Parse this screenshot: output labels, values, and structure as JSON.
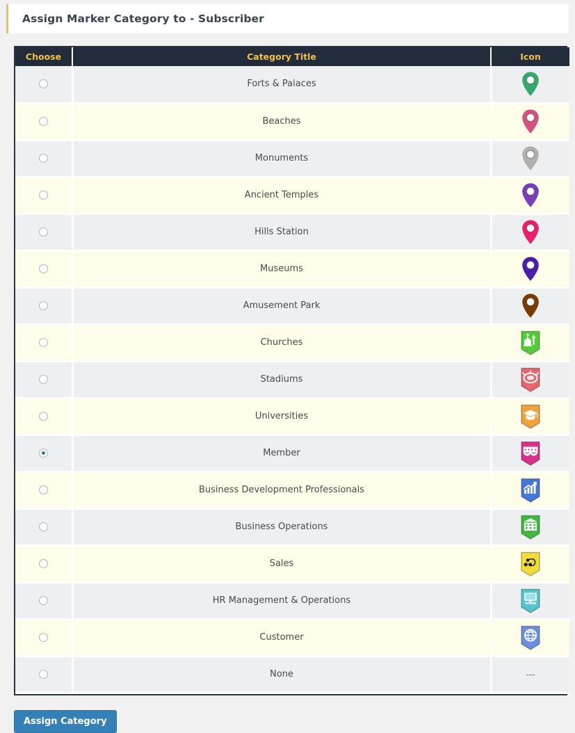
{
  "header": {
    "title": "Assign Marker Category to - Subscriber",
    "accent_color": "#e8c44a"
  },
  "table": {
    "columns": {
      "choose": "Choose",
      "title": "Category Title",
      "icon": "Icon"
    },
    "header_bg": "#232c3b",
    "header_text_color": "#f0c040",
    "row_odd_bg": "#eeeff0",
    "row_even_bg": "#fdfde9",
    "selected_radio_color": "#2e7ba6",
    "rows": [
      {
        "title": "Forts & Palaces",
        "icon": "map-pin-icon",
        "icon_color": "#36a86b",
        "selected": false
      },
      {
        "title": "Beaches",
        "icon": "map-pin-icon",
        "icon_color": "#d2537f",
        "selected": false
      },
      {
        "title": "Monuments",
        "icon": "map-pin-icon",
        "icon_color": "#b0b0b0",
        "selected": false
      },
      {
        "title": "Ancient Temples",
        "icon": "map-pin-icon",
        "icon_color": "#7b3fb5",
        "selected": false
      },
      {
        "title": "Hills Station",
        "icon": "map-pin-icon",
        "icon_color": "#ec1e6e",
        "selected": false
      },
      {
        "title": "Museums",
        "icon": "map-pin-icon",
        "icon_color": "#4b1fa8",
        "selected": false
      },
      {
        "title": "Amusement Park",
        "icon": "map-pin-icon",
        "icon_color": "#7a3b06",
        "selected": false
      },
      {
        "title": "Churches",
        "icon": "church-badge-icon",
        "icon_color": "#54cc3a",
        "selected": false
      },
      {
        "title": "Stadiums",
        "icon": "stadium-badge-icon",
        "icon_color": "#e8656a",
        "selected": false
      },
      {
        "title": "Universities",
        "icon": "graduation-cap-badge-icon",
        "icon_color": "#f0a23c",
        "selected": false
      },
      {
        "title": "Member",
        "icon": "theater-masks-badge-icon",
        "icon_color": "#d9308e",
        "selected": true
      },
      {
        "title": "Business Development Professionals",
        "icon": "growth-chart-badge-icon",
        "icon_color": "#4575d6",
        "selected": false
      },
      {
        "title": "Business Operations",
        "icon": "office-building-badge-icon",
        "icon_color": "#3cbb3c",
        "selected": false
      },
      {
        "title": "Sales",
        "icon": "sales-network-badge-icon",
        "icon_color": "#f2dc3a",
        "selected": false
      },
      {
        "title": "HR Management & Operations",
        "icon": "computer-monitor-badge-icon",
        "icon_color": "#4fc7cd",
        "selected": false
      },
      {
        "title": "Customer",
        "icon": "currency-globe-badge-icon",
        "icon_color": "#6b8ede",
        "selected": false
      },
      {
        "title": "None",
        "icon": "no-icon-dashes",
        "icon_color": "",
        "selected": false,
        "icon_text": "---"
      }
    ]
  },
  "footer": {
    "assign_button": "Assign Category",
    "button_color": "#3481b8"
  }
}
